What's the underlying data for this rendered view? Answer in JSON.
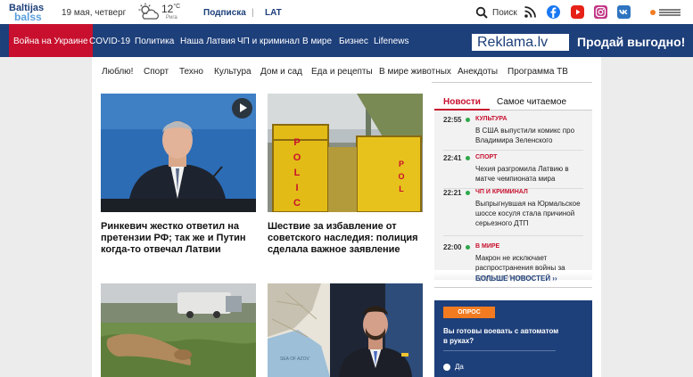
{
  "topbar": {
    "logo_line1": "Baltijas",
    "logo_line2": "balss",
    "date": "19 мая, четверг",
    "weather": {
      "temperature": "12",
      "unit": "°C",
      "city": "Рига"
    },
    "subscribe": "Подписка",
    "separator": "|",
    "lang": "LAT",
    "search": "Поиск",
    "social": [
      "rss-icon",
      "facebook-icon",
      "youtube-icon",
      "instagram-icon",
      "vk-icon"
    ]
  },
  "nav": {
    "items": [
      "Война на Украине",
      "COVID-19",
      "Политика",
      "Наша Латвия",
      "ЧП и криминал",
      "В мире",
      "Бизнес",
      "Lifenews"
    ],
    "active_index": 0
  },
  "banner": {
    "brand": "Reklama.lv",
    "slogan": "Продай выгодно!"
  },
  "subnav": [
    "Люблю!",
    "Спорт",
    "Техно",
    "Культура",
    "Дом и сад",
    "Еда и рецепты",
    "В мире животных",
    "Анекдоты",
    "Программа ТВ"
  ],
  "articles": [
    {
      "title": "Ринкевич жестко ответил на претензии РФ; так же и Путин когда-то отвечал Латвии",
      "has_video": true
    },
    {
      "title": "Шествие за избавление от советского наследия: полиция сделала важное заявление",
      "sign_text": "POLICIJA"
    },
    {
      "title": ""
    },
    {
      "title": "",
      "map_label": "SEA OF AZOV"
    }
  ],
  "news_panel": {
    "tabs": [
      "Новости",
      "Самое читаемое"
    ],
    "active_tab": 0,
    "items": [
      {
        "time": "22:55",
        "category": "КУЛЬТУРА",
        "title": "В США выпустили комикс про Владимира Зеленского"
      },
      {
        "time": "22:41",
        "category": "СПОРТ",
        "title": "Чехия разгромила Латвию в матче чемпионата мира"
      },
      {
        "time": "22:21",
        "category": "ЧП И КРИМИНАЛ",
        "title": "Выпрыгнувшая на Юрмальское шоссе косуля стала причиной серьезного ДТП"
      },
      {
        "time": "22:00",
        "category": "В МИРЕ",
        "title": "Макрон не исключает распространения войны за пределы Украины"
      }
    ],
    "more": "БОЛЬШЕ НОВОСТЕЙ  ››"
  },
  "poll": {
    "badge": "ОПРОС",
    "question": "Вы готовы воевать с автоматом в руках?",
    "options": [
      "Да"
    ]
  },
  "colors": {
    "brand_blue": "#1d3f7a",
    "accent_red": "#c8102e",
    "poll_orange": "#f27b21",
    "live_green": "#2ea84a"
  }
}
